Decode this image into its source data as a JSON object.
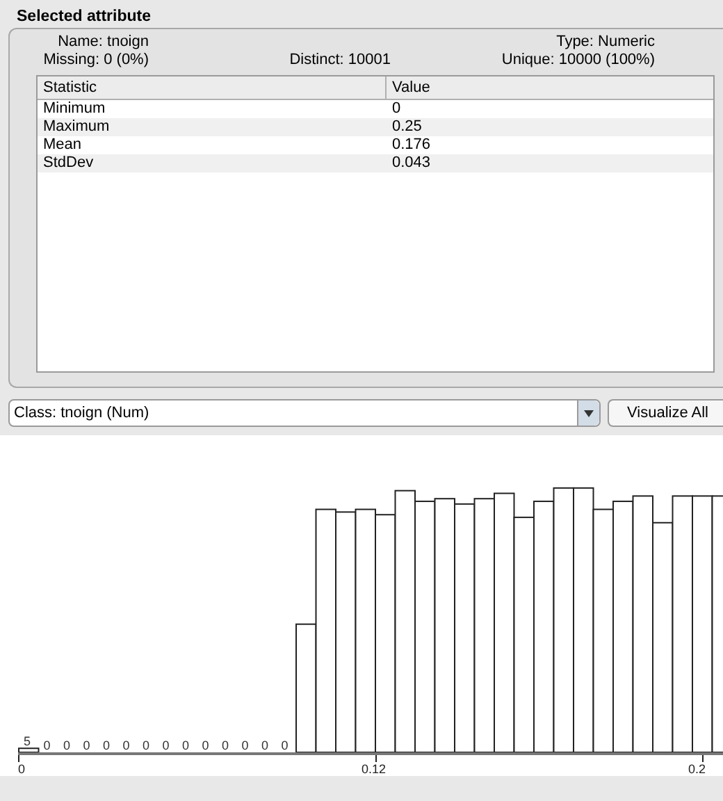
{
  "panel": {
    "title": "Selected attribute",
    "info": {
      "name": "Name: tnoign",
      "missing": "Missing: 0 (0%)",
      "distinct": "Distinct: 10001",
      "type": "Type: Numeric",
      "unique": "Unique: 10000 (100%)"
    },
    "table": {
      "columns": [
        "Statistic",
        "Value"
      ],
      "rows": [
        [
          "Minimum",
          "0"
        ],
        [
          "Maximum",
          "0.25"
        ],
        [
          "Mean",
          "0.176"
        ],
        [
          "StdDev",
          "0.043"
        ]
      ]
    }
  },
  "class_selector": {
    "value": "Class: tnoign (Num)"
  },
  "visualize_button": "Visualize All",
  "histogram": {
    "count_labels": [
      "5",
      "0",
      "0",
      "0",
      "0",
      "0",
      "0",
      "0",
      "0",
      "0",
      "0",
      "0",
      "0",
      "0"
    ],
    "tick_labels": [
      "0",
      "0.12",
      "0.2"
    ]
  }
}
